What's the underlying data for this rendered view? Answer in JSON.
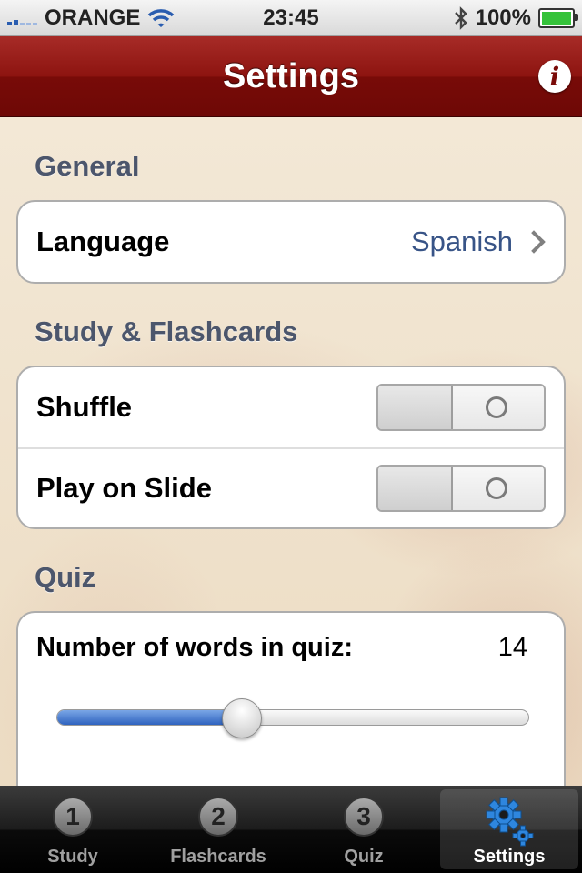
{
  "status_bar": {
    "carrier": "ORANGE",
    "time": "23:45",
    "battery": "100%"
  },
  "nav": {
    "title": "Settings",
    "info_label": "i"
  },
  "sections": {
    "general": {
      "title": "General",
      "language_label": "Language",
      "language_value": "Spanish"
    },
    "study": {
      "title": "Study & Flashcards",
      "shuffle_label": "Shuffle",
      "shuffle_on": false,
      "play_label": "Play on Slide",
      "play_on": false
    },
    "quiz": {
      "title": "Quiz",
      "words_label": "Number of words in quiz:",
      "words_value": "14",
      "slider_fraction": 0.39
    }
  },
  "tabs": [
    {
      "label": "Study",
      "badge": "1",
      "icon": "badge-1-icon",
      "selected": false
    },
    {
      "label": "Flashcards",
      "badge": "2",
      "icon": "badge-2-icon",
      "selected": false
    },
    {
      "label": "Quiz",
      "badge": "3",
      "icon": "badge-3-icon",
      "selected": false
    },
    {
      "label": "Settings",
      "icon": "gear-icon",
      "selected": true
    }
  ],
  "colors": {
    "nav_red": "#8d1410",
    "section_title": "#4c566c",
    "value_blue": "#385487",
    "slider_blue": "#2f63bf",
    "gear_blue": "#2e86de"
  }
}
